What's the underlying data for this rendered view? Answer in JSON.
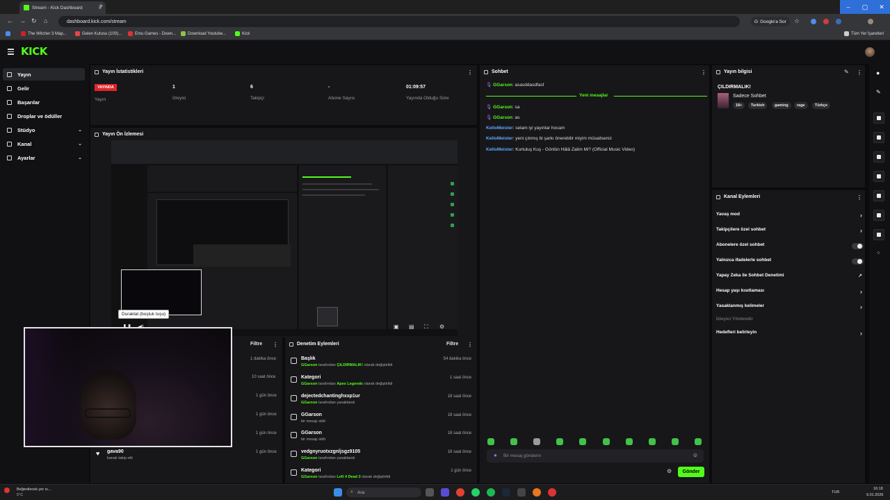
{
  "browser": {
    "tab_title": "Stream - Kick Dashboard",
    "url": "dashboard.kick.com/stream",
    "google_sor": "Google'a Sor",
    "tum_yer_isaretleri": "Tüm Yer İşaretleri",
    "bookmarks": [
      "The Witcher 3 Map...",
      "Gelen Kutusu (100)...",
      "Emu Games - Down...",
      "Download Youtube...",
      "Kick"
    ]
  },
  "kick": {
    "logo": "KICK"
  },
  "sidebar": {
    "items": [
      {
        "label": "Yayın"
      },
      {
        "label": "Gelir"
      },
      {
        "label": "Başarılar"
      },
      {
        "label": "Droplar ve ödüller"
      },
      {
        "label": "Stüdyo"
      },
      {
        "label": "Kanal"
      },
      {
        "label": "Ayarlar"
      }
    ]
  },
  "stats": {
    "title": "Yayın İstatistikleri",
    "live_badge": "YAYINDA",
    "yayin": "Yayın",
    "izleyici_value": "1",
    "izleyici_label": "İzleyici",
    "takipci_value": "6",
    "takipci_label": "Takipçi",
    "abone_value": "-",
    "abone_label": "Abone Sayısı",
    "sure_value": "01:09:57",
    "sure_label": "Yayında Olduğu Süre"
  },
  "preview": {
    "title": "Yayın Ön İzlemesi",
    "tooltip": "Duraklat (boşluk tuşu)"
  },
  "follows": {
    "filter": "Filtre",
    "times": [
      "1 dakika önce",
      "10 saat önce",
      "1 gün önce",
      "1 gün önce",
      "1 gün önce",
      "1 gün önce"
    ],
    "last_user": "gava90",
    "last_action": "kanalı takip etti"
  },
  "moderation": {
    "title": "Denetim Eylemleri",
    "filter": "Filtre",
    "rows": [
      {
        "title": "Başlık",
        "user": "GGarson",
        "pre": "tarafından",
        "val": "ÇILDIRMALIK!",
        "post": "olarak değiştirildi",
        "time": "54 dakika önce"
      },
      {
        "title": "Kategori",
        "user": "GGarson",
        "pre": "tarafından",
        "val": "Apex Legends",
        "post": "olarak değiştirildi",
        "time": "1 saat önce"
      },
      {
        "title": "dejectedchantinghxxp1ur",
        "user": "GGarson",
        "pre": "tarafından",
        "val": "",
        "post": "yasaklandı",
        "time": "18 saat önce"
      },
      {
        "title": "GGarson",
        "user": "",
        "pre": "bir mesajı sildi",
        "val": "",
        "post": "",
        "time": "18 saat önce"
      },
      {
        "title": "GGarson",
        "user": "",
        "pre": "bir mesajı sildi",
        "val": "",
        "post": "",
        "time": "18 saat önce"
      },
      {
        "title": "vedgnyruotxzgnljsgz9105",
        "user": "GGarson",
        "pre": "tarafından",
        "val": "",
        "post": "yasaklandı",
        "time": "18 saat önce"
      },
      {
        "title": "Kategori",
        "user": "GGarson",
        "pre": "tarafından",
        "val": "Left 4 Dead 2",
        "post": "olarak değiştirildi",
        "time": "1 gün önce"
      }
    ]
  },
  "chat": {
    "title": "Sohbet",
    "new_messages": "Yeni mesajlar",
    "messages": [
      {
        "user": "GGarson",
        "text": "asasddasdfasf",
        "color": "#53fc18"
      },
      {
        "user": "GGarson",
        "text": "sa",
        "color": "#53fc18"
      },
      {
        "user": "GGarson",
        "text": "as",
        "color": "#53fc18"
      },
      {
        "user": "KelloMeister",
        "text": "selam iyi yayınlar hocam",
        "color": "#5fa7ff"
      },
      {
        "user": "KelloMeister",
        "text": "yeni çıkmış bi şarkı önerebilir miyim müsaitseniz",
        "color": "#5fa7ff"
      },
      {
        "user": "KelloMeister",
        "text": "Kurtuluş Kuş - Gönlün Hâlâ Zalim Mi? (Official Music Video)",
        "color": "#5fa7ff"
      }
    ],
    "placeholder": "Bir mesaj gönderin",
    "send": "Gönder"
  },
  "stream_info": {
    "title": "Yayın bilgisi",
    "stream_title": "ÇILDIRMALIK!",
    "category": "Sadece Sohbet",
    "tags": [
      "18+",
      "Turkish",
      "gaming",
      "rage",
      "Türkçe"
    ]
  },
  "channel_actions": {
    "title": "Kanal Eylemleri",
    "items": [
      "Yavaş mod",
      "Takipçilere özel sohbet",
      "Abonelere özel sohbet",
      "Yalnızca ifadelerle sohbet",
      "Yapay Zeka ile Sohbet Denetimi",
      "Hesap yaşı kısıtlaması",
      "Yasaklanmış kelimeler",
      "İzleyici Yönlendir",
      "Hedefleri belirleyin"
    ]
  },
  "taskbar": {
    "weather": "Beğenilecek yer sı...",
    "temp": "5°C",
    "search": "Ara",
    "lang": "TUR",
    "time": "16:18",
    "date": "9.01.2026"
  },
  "colors": {
    "accent": "#53fc18",
    "live": "#e0262a"
  }
}
